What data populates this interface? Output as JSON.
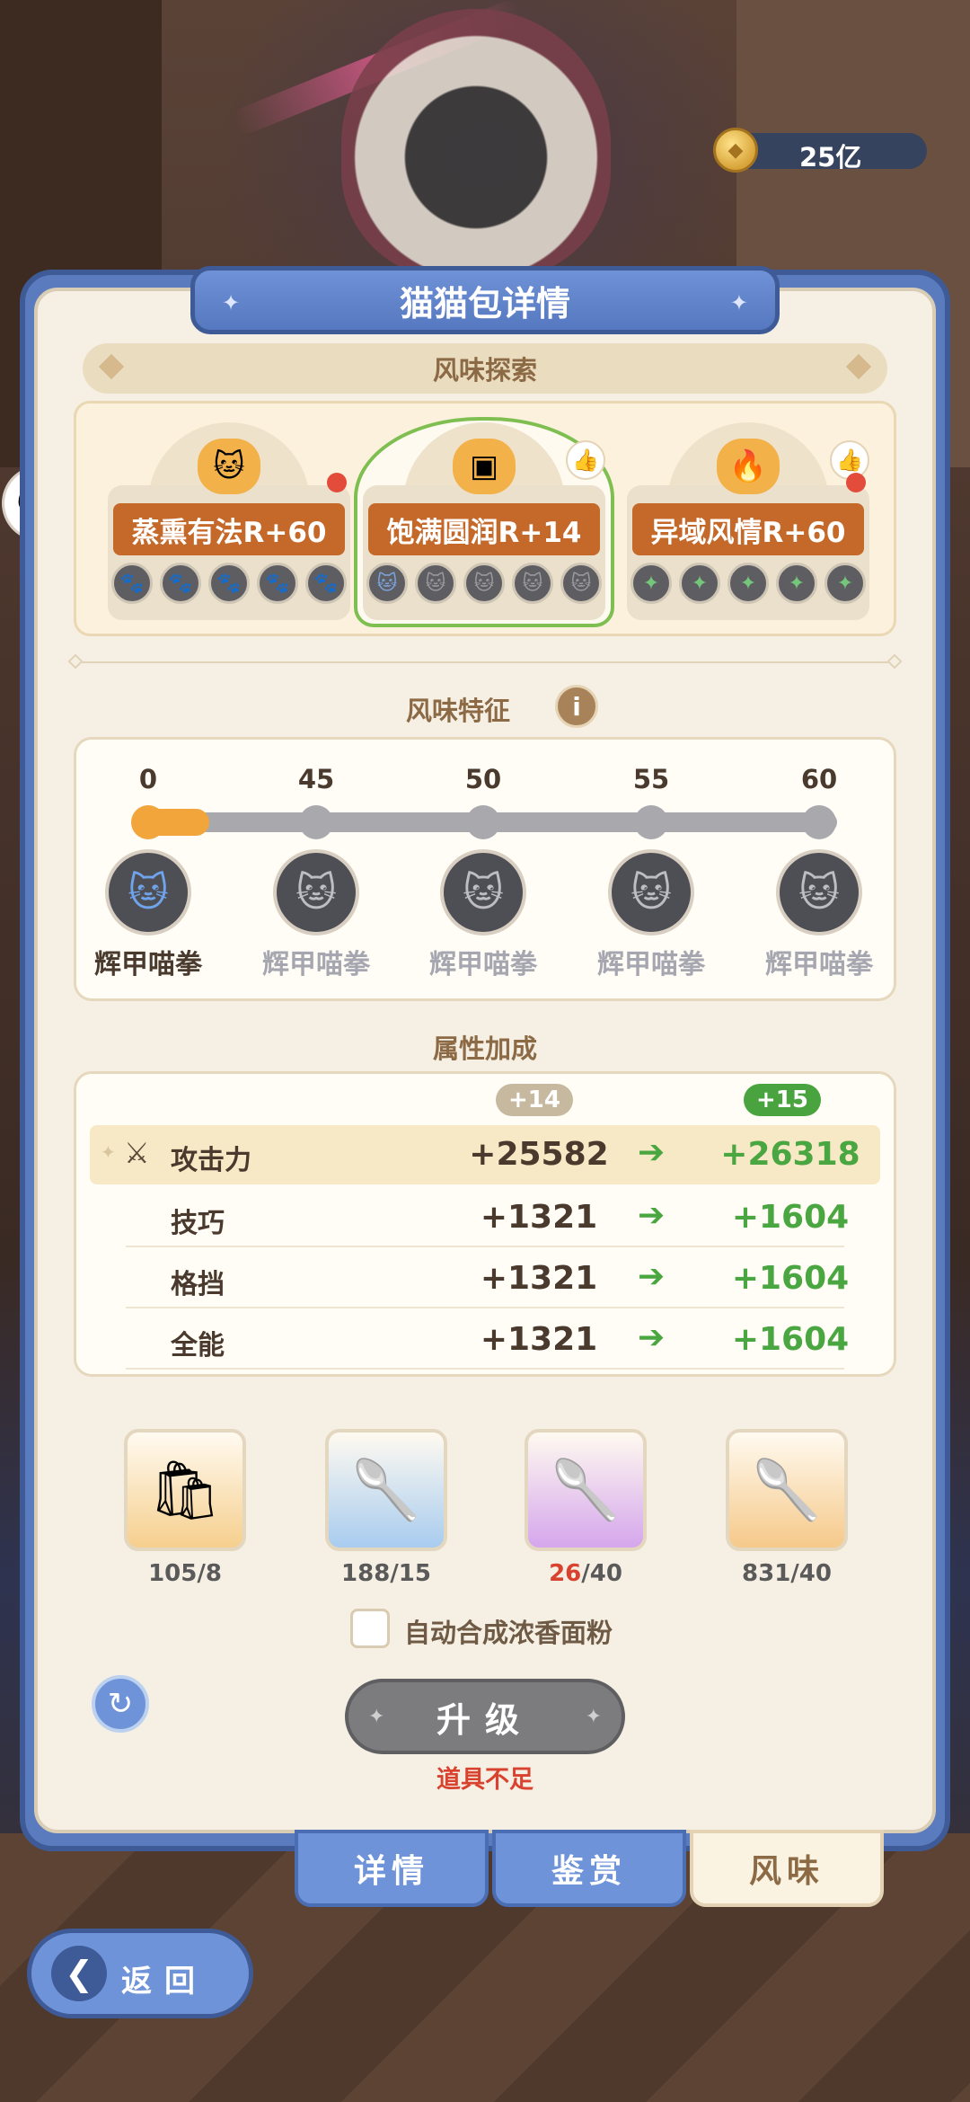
{
  "currency": {
    "amount": "25亿",
    "icon": "coin-icon"
  },
  "panel": {
    "title": "猫猫包详情"
  },
  "flavor_explore": {
    "title": "风味探索",
    "cards": [
      {
        "label": "蒸熏有法R+60",
        "emblem": "🐱",
        "emblem_color": "#f3b14a",
        "icon_color": "#e08585",
        "icon_glyph": "🐾",
        "has_dot": true,
        "has_thumb": false,
        "selected": false
      },
      {
        "label": "饱满圆润R+14",
        "emblem": "▣",
        "emblem_color": "#f3b14a",
        "icon_color": "#7aa5e0",
        "icon_glyph": "🐱",
        "has_dot": false,
        "has_thumb": true,
        "selected": true
      },
      {
        "label": "异域风情R+60",
        "emblem": "🔥",
        "emblem_color": "#f3b14a",
        "icon_color": "#74c77a",
        "icon_glyph": "✦",
        "has_dot": true,
        "has_thumb": true,
        "selected": false
      }
    ]
  },
  "flavor_traits": {
    "title": "风味特征",
    "values": [
      "0",
      "45",
      "50",
      "55",
      "60"
    ],
    "names": [
      "辉甲喵拳",
      "辉甲喵拳",
      "辉甲喵拳",
      "辉甲喵拳",
      "辉甲喵拳"
    ],
    "unlocked_count": 1,
    "progress": 0.02
  },
  "attributes": {
    "title": "属性加成",
    "current_level": "+14",
    "next_level": "+15",
    "rows": [
      {
        "name": "攻击力",
        "current": "+25582",
        "next": "+26318",
        "highlight": true
      },
      {
        "name": "技巧",
        "current": "+1321",
        "next": "+1604",
        "highlight": false
      },
      {
        "name": "格挡",
        "current": "+1321",
        "next": "+1604",
        "highlight": false
      },
      {
        "name": "全能",
        "current": "+1321",
        "next": "+1604",
        "highlight": false
      }
    ]
  },
  "materials": [
    {
      "name": "flour-bag",
      "glyph": "🛍",
      "have": "105",
      "need": "/8",
      "insufficient": false,
      "bg": "#f6cf8e"
    },
    {
      "name": "paw-spoon",
      "glyph": "🥄",
      "have": "188",
      "need": "/15",
      "insufficient": false,
      "bg": "#a8ccef"
    },
    {
      "name": "cat-spoon",
      "glyph": "🥄",
      "have": "26",
      "need": "/40",
      "insufficient": true,
      "bg": "#d5a6ec"
    },
    {
      "name": "gold-spoon",
      "glyph": "🥄",
      "have": "831",
      "need": "/40",
      "insufficient": false,
      "bg": "#f6c98a"
    }
  ],
  "auto_craft": {
    "label": "自动合成浓香面粉",
    "checked": false
  },
  "upgrade": {
    "label": "升级",
    "warning": "道具不足"
  },
  "tabs": [
    {
      "label": "详情",
      "active": false
    },
    {
      "label": "鉴赏",
      "active": false
    },
    {
      "label": "风味",
      "active": true
    }
  ],
  "back": {
    "label": "返回"
  }
}
